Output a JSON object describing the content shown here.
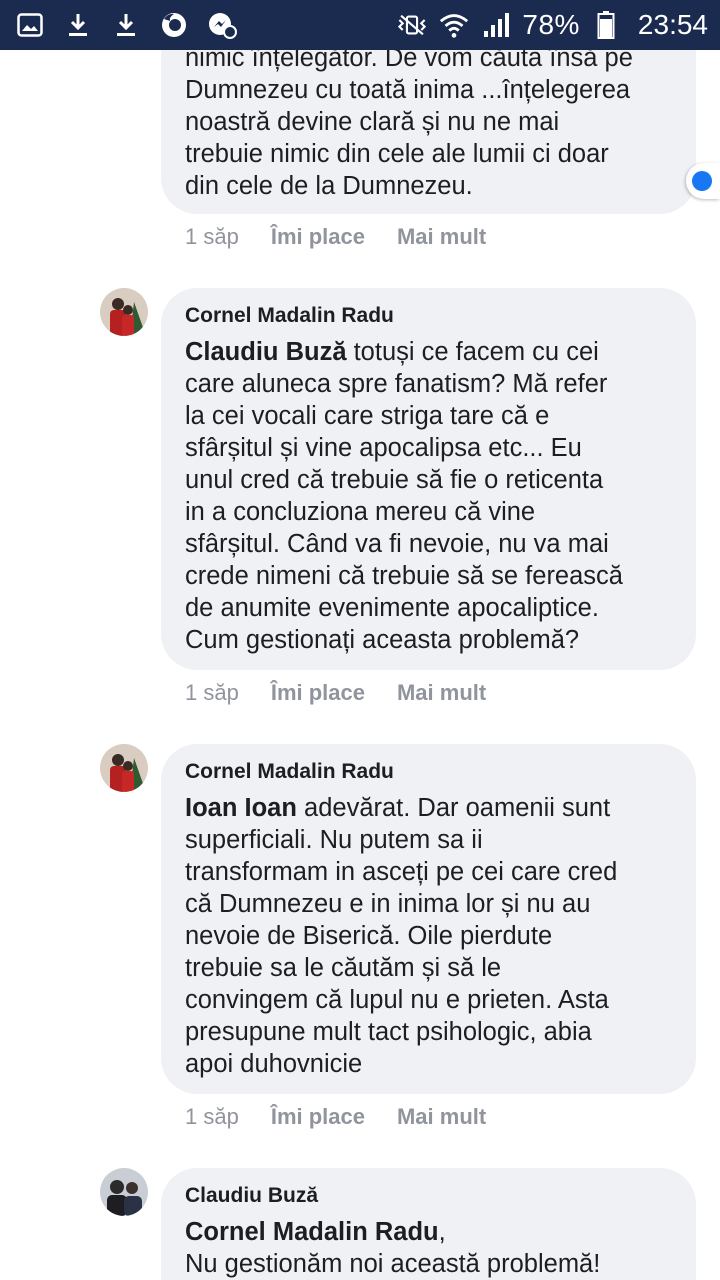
{
  "status_bar": {
    "battery": "78%",
    "time": "23:54",
    "icons": [
      "image-icon",
      "download-icon",
      "download-icon",
      "firefox-icon",
      "facebook-messenger-icon",
      "vibrate-icon",
      "wifi-icon",
      "signal-icon",
      "battery-icon"
    ]
  },
  "comments": [
    {
      "author": "",
      "mention": "",
      "lines": [
        "nimic înțelegător. De vom căuta însă pe",
        "Dumnezeu cu toată inima ...înțelegerea",
        "noastră devine clară și nu ne mai",
        "trebuie nimic din cele ale lumii ci doar",
        "din cele de la Dumnezeu."
      ],
      "time": "1 săp",
      "like": "Îmi place",
      "more": "Mai mult"
    },
    {
      "author": "Cornel Madalin Radu",
      "mention": "Claudiu Buză",
      "first_line_rest": " totuși ce facem cu cei",
      "lines": [
        "care aluneca spre fanatism? Mă refer",
        "la cei vocali care striga tare că e",
        "sfârșitul și vine apocalipsa etc... Eu",
        "unul cred că trebuie să fie o reticenta",
        "in a concluziona mereu că vine",
        "sfârșitul. Când va fi nevoie, nu va mai",
        "crede nimeni că trebuie să se ferească",
        "de anumite evenimente apocaliptice.",
        "Cum gestionați aceasta problemă?"
      ],
      "time": "1 săp",
      "like": "Îmi place",
      "more": "Mai mult"
    },
    {
      "author": "Cornel Madalin Radu",
      "mention": "Ioan Ioan",
      "first_line_rest": " adevărat. Dar oamenii sunt",
      "lines": [
        "superficiali. Nu putem sa ii",
        "transformam in asceți pe cei care cred",
        "că Dumnezeu e in inima lor și nu au",
        "nevoie de Biserică. Oile pierdute",
        "trebuie sa le căutăm și să le",
        "convingem că lupul nu e prieten. Asta",
        "presupune mult tact psihologic, abia",
        "apoi duhovnicie"
      ],
      "time": "1 săp",
      "like": "Îmi place",
      "more": "Mai mult"
    },
    {
      "author": "Claudiu Buză",
      "mention": "Cornel Madalin Radu",
      "first_line_rest": ",",
      "lines": [
        "Nu gestionăm noi această problemă!"
      ]
    }
  ]
}
